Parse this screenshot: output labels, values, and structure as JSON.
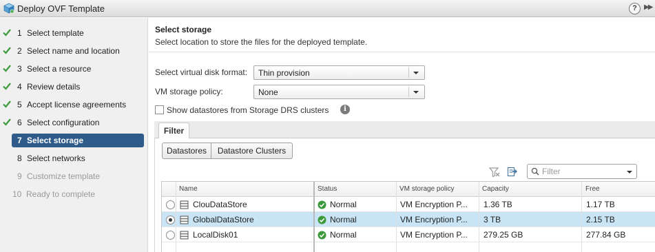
{
  "window": {
    "title": "Deploy OVF Template",
    "help_label": "?",
    "more_label": "▶▶"
  },
  "steps": [
    {
      "num": "1",
      "label": "Select template",
      "done": true
    },
    {
      "num": "2",
      "label": "Select name and location",
      "done": true
    },
    {
      "num": "3",
      "label": "Select a resource",
      "done": true
    },
    {
      "num": "4",
      "label": "Review details",
      "done": true
    },
    {
      "num": "5",
      "label": "Accept license agreements",
      "done": true
    },
    {
      "num": "6",
      "label": "Select configuration",
      "done": true
    },
    {
      "num": "7",
      "label": "Select storage",
      "active": true
    },
    {
      "num": "8",
      "label": "Select networks"
    },
    {
      "num": "9",
      "label": "Customize template",
      "disabled": true
    },
    {
      "num": "10",
      "label": "Ready to complete",
      "disabled": true
    }
  ],
  "main": {
    "title": "Select storage",
    "subtitle": "Select location to store the files for the deployed template.",
    "disk_format": {
      "label": "Select virtual disk format:",
      "value": "Thin provision"
    },
    "storage_policy": {
      "label": "VM storage policy:",
      "value": "None"
    },
    "show_drs": {
      "label": "Show datastores from Storage DRS clusters",
      "checked": false
    },
    "info_glyph": "i",
    "tab_filter": "Filter",
    "seg_datastores": "Datastores",
    "seg_clusters": "Datastore Clusters",
    "search_placeholder": "Filter"
  },
  "table": {
    "columns": [
      "Name",
      "Status",
      "VM storage policy",
      "Capacity",
      "Free"
    ],
    "rows": [
      {
        "name": "ClouDataStore",
        "status": "Normal",
        "policy": "VM Encryption P...",
        "capacity": "1.36 TB",
        "free": "1.17 TB",
        "selected": false
      },
      {
        "name": "GlobalDataStore",
        "status": "Normal",
        "policy": "VM Encryption P...",
        "capacity": "3 TB",
        "free": "2.15 TB",
        "selected": true
      },
      {
        "name": "LocalDisk01",
        "status": "Normal",
        "policy": "VM Encryption P...",
        "capacity": "279.25 GB",
        "free": "277.84 GB",
        "selected": false
      }
    ]
  },
  "colors": {
    "accent": "#2e5b8a",
    "check": "#3c9a3c",
    "selected_row": "#c9e5f5"
  }
}
